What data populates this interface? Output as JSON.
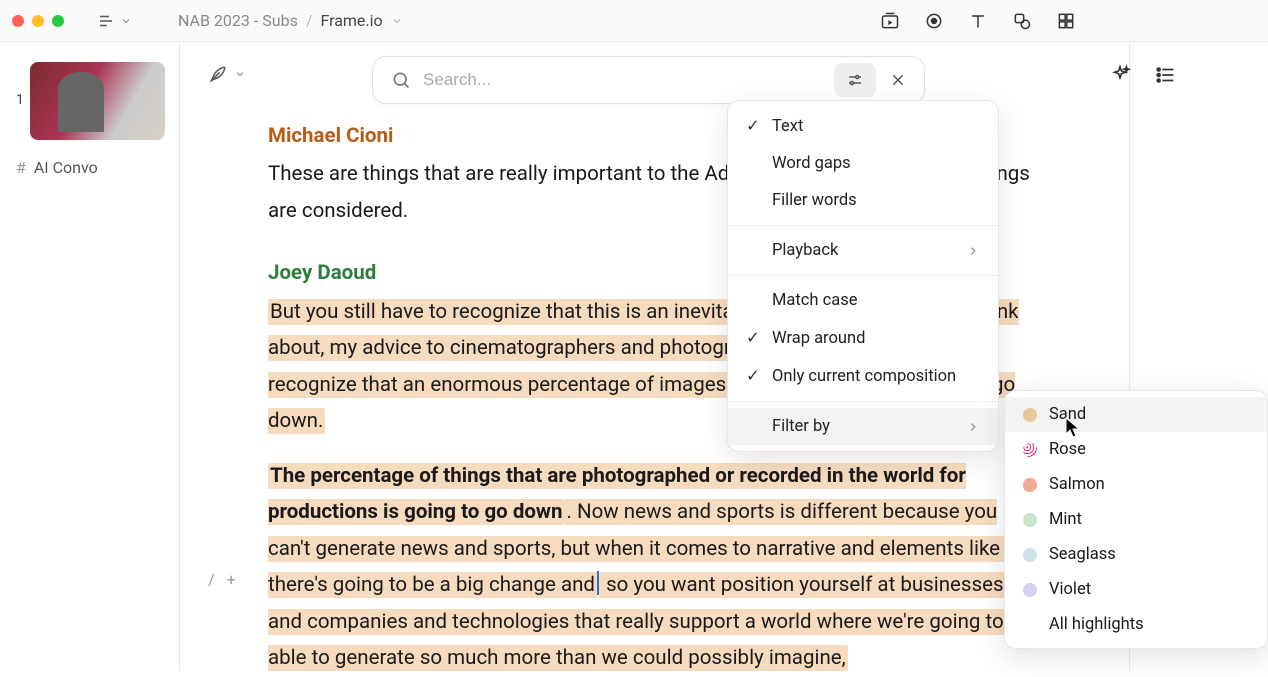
{
  "top": {
    "project": "NAB 2023 - Subs",
    "page": "Frame.io"
  },
  "sidebar": {
    "thumb_number": "1",
    "items": [
      {
        "label": "AI Convo"
      }
    ]
  },
  "search": {
    "placeholder": "Search..."
  },
  "transcript": {
    "speakers": [
      {
        "name": "Michael Cioni",
        "class": "michael"
      },
      {
        "name": "Joey Daoud",
        "class": "joey"
      }
    ],
    "para1": "These are things that are really important to the Adobe community, and these things are considered.",
    "joey": {
      "seg1_a": "But you still have to recognize that this is an inevitability.",
      "seg1_b": " And when he has to think about, my advice to cinematographers and photographers in general, is to really recognize that an enormous percentage of images that are recorded is going to go down.",
      "bold": "The percentage of things that are photographed or recorded in the world for productions is going to go down",
      "after_bold_a": ". Now news and sports is different because you can't generate news and sports, but when it comes to narrative and elements like that there's going to be a big change and",
      "after_bold_b": " so you want position yourself at businesses and companies and technologies that really support a world where we're going to be able to generate so much more than we could possibly imagine,"
    }
  },
  "dropdown": {
    "items": [
      {
        "label": "Text",
        "checked": true
      },
      {
        "label": "Word gaps",
        "checked": false
      },
      {
        "label": "Filler words",
        "checked": false
      }
    ],
    "playback": {
      "label": "Playback"
    },
    "options": [
      {
        "label": "Match case",
        "checked": false
      },
      {
        "label": "Wrap around",
        "checked": true
      },
      {
        "label": "Only current composition",
        "checked": true
      }
    ],
    "filter_by": {
      "label": "Filter by"
    }
  },
  "submenu": {
    "colors": [
      {
        "key": "sand",
        "label": "Sand"
      },
      {
        "key": "rose",
        "label": "Rose"
      },
      {
        "key": "salmon",
        "label": "Salmon"
      },
      {
        "key": "mint",
        "label": "Mint"
      },
      {
        "key": "seaglass",
        "label": "Seaglass"
      },
      {
        "key": "violet",
        "label": "Violet"
      }
    ],
    "all": "All highlights"
  }
}
